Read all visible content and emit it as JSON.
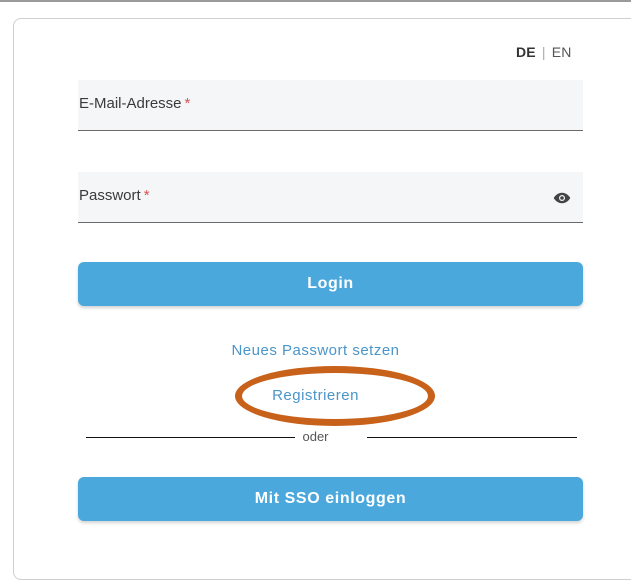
{
  "language": {
    "de": "DE",
    "separator": "|",
    "en": "EN"
  },
  "form": {
    "email_label": "E-Mail-Adresse",
    "password_label": "Passwort",
    "required_marker": "*",
    "login_label": "Login",
    "reset_password_label": "Neues Passwort setzen",
    "register_label": "Registrieren",
    "divider_text": "oder",
    "sso_label": "Mit SSO einloggen"
  },
  "icons": {
    "password_toggle": "eye-icon"
  },
  "colors": {
    "primary": "#4aa8dd",
    "link": "#4a95c9",
    "highlight_circle": "#c8611a",
    "required": "#d9534f"
  }
}
